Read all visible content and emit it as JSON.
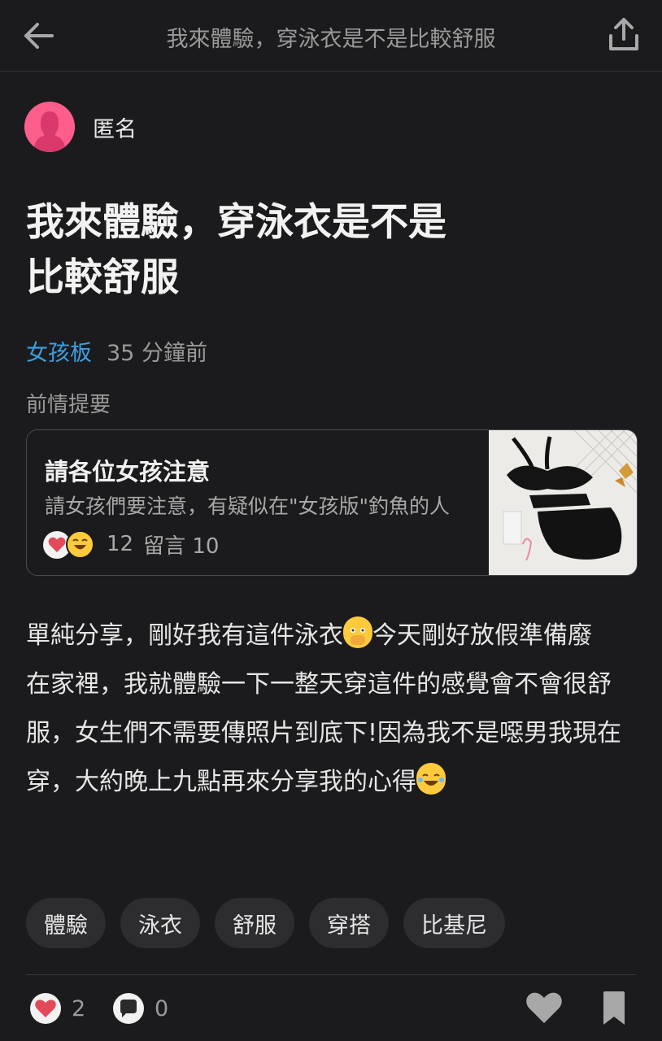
{
  "header": {
    "back_icon": "arrow-left-icon",
    "title": "我來體驗，穿泳衣是不是比較舒服",
    "share_icon": "share-icon"
  },
  "author": {
    "name": "匿名",
    "avatar_icon": "female-avatar-icon"
  },
  "post": {
    "title_line1": "我來體驗，穿泳衣是不是",
    "title_line2": "比較舒服",
    "board": "女孩板",
    "time": "35 分鐘前"
  },
  "previous": {
    "label": "前情提要",
    "card": {
      "title": "請各位女孩注意",
      "excerpt": "請女孩們要注意，有疑似在\"女孩版\"釣魚的人",
      "reactions_count": "12",
      "comments": "留言 10",
      "thumbnail_icon": "swimsuit-photo"
    }
  },
  "body": {
    "line1_a": "單純分享，剛好我有這件泳衣",
    "line1_b": "今天剛好放假準備廢",
    "line2": "在家裡，我就體驗一下一整天穿這件的感覺會不會很舒服，女生們不需要傳照片到底下!因為我不是噁男我現在穿，大約晚上九點再來分享我的心得",
    "emoji1": "face-with-open-eyes-and-hand-over-mouth-emoji",
    "emoji2": "face-with-tears-of-joy-emoji"
  },
  "tags": [
    "體驗",
    "泳衣",
    "舒服",
    "穿搭",
    "比基尼"
  ],
  "footer": {
    "likes": "2",
    "comments": "0",
    "colors": {
      "heart": "#e24a5a",
      "board": "#3b9fe0",
      "avatar": "#ff5d8c"
    }
  }
}
